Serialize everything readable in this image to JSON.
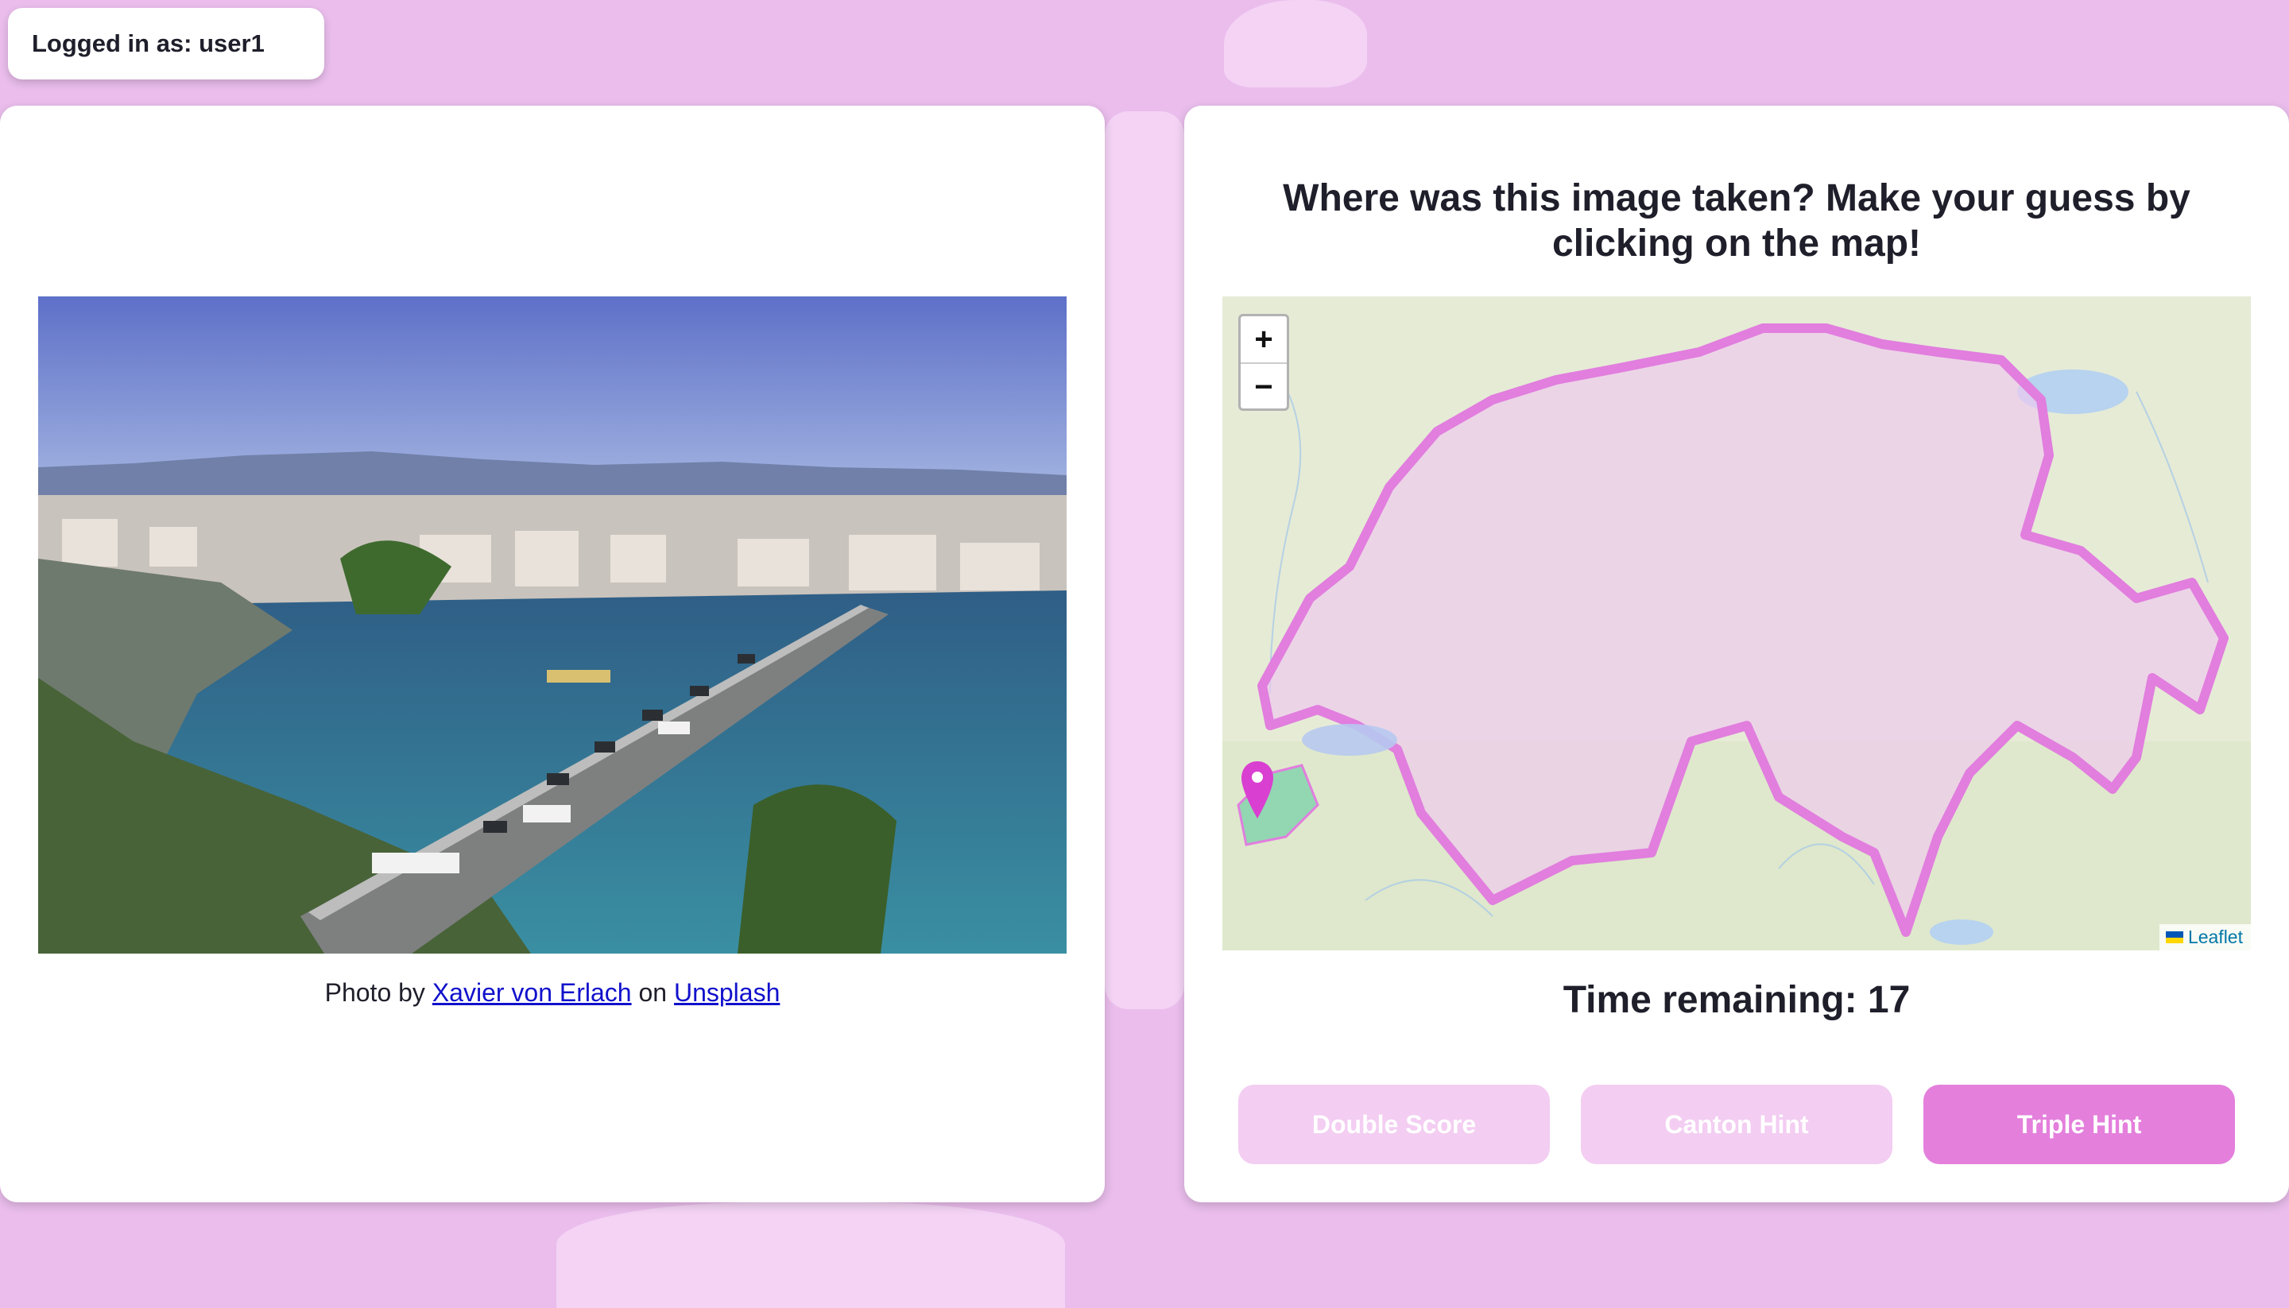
{
  "user": {
    "label": "Logged in as: user1"
  },
  "photo": {
    "prefix": "Photo by ",
    "author": "Xavier von Erlach",
    "middle": " on ",
    "source": "Unsplash"
  },
  "game": {
    "question": "Where was this image taken? Make your guess by clicking on the map!",
    "timer": "Time remaining: 17"
  },
  "map": {
    "zoom_in": "+",
    "zoom_out": "−",
    "attribution": "Leaflet",
    "marker_icon": "map-pin-icon"
  },
  "buttons": [
    {
      "label": "Double Score",
      "state": "disabled"
    },
    {
      "label": "Canton Hint",
      "state": "disabled"
    },
    {
      "label": "Triple Hint",
      "state": "active"
    }
  ],
  "colors": {
    "background": "#eabdec",
    "accent": "#e47fdc",
    "disabled_button": "#f3cdf2",
    "border_outline": "#e17ede",
    "marker": "#d93fd0"
  }
}
